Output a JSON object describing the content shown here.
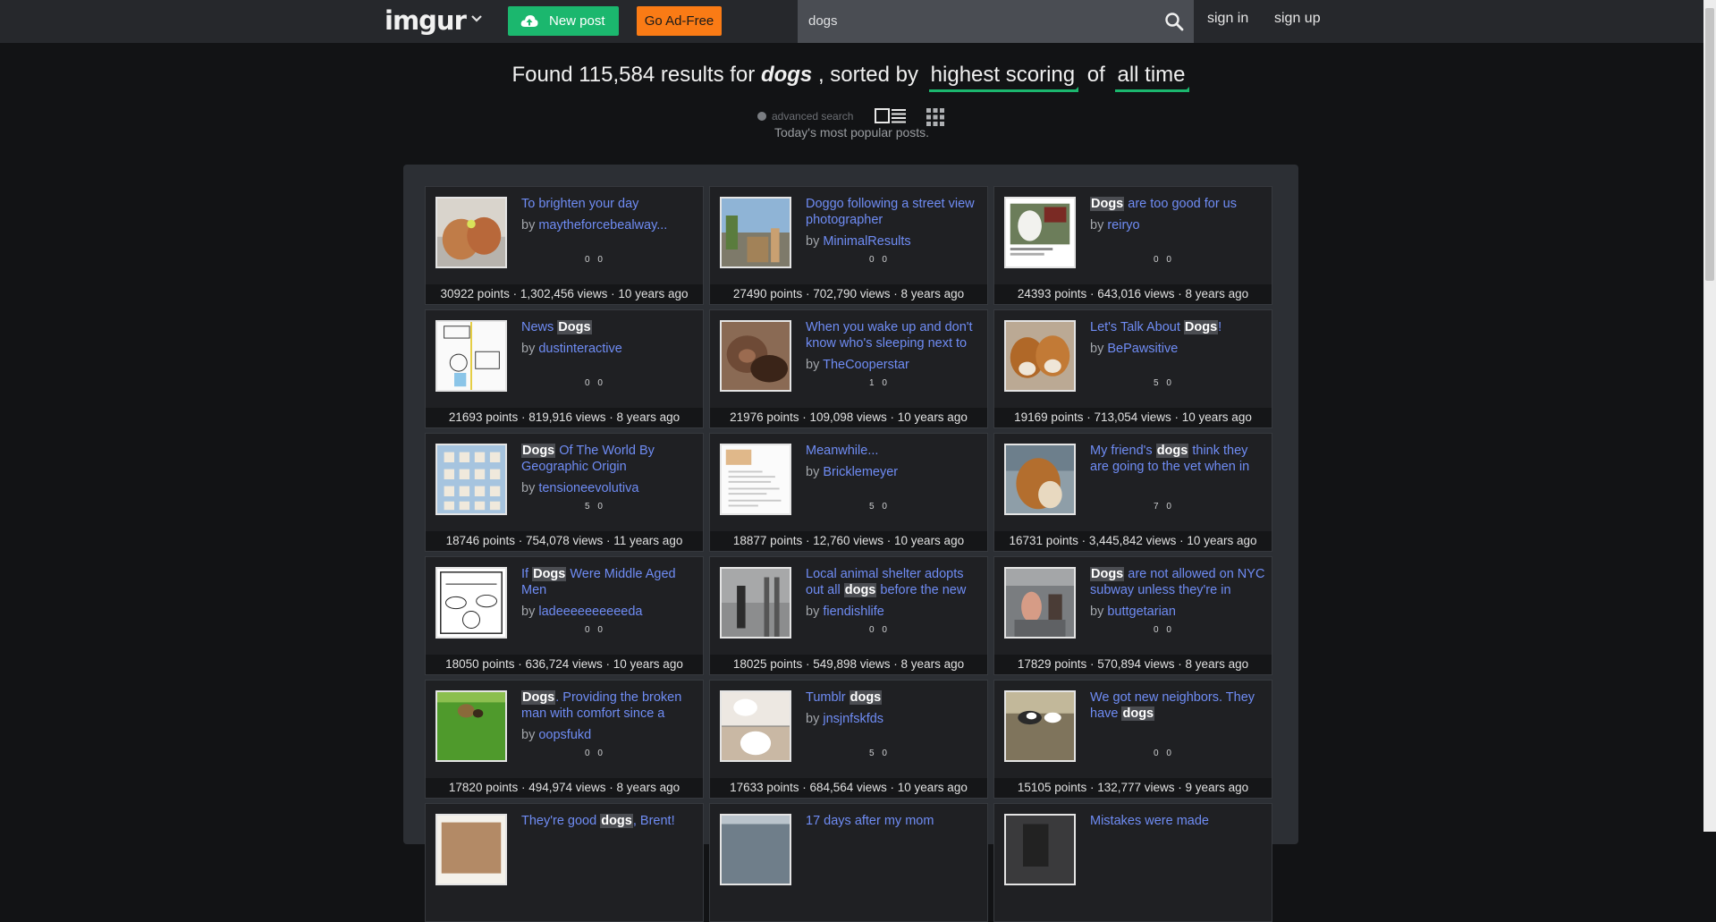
{
  "nav": {
    "logo": "imgur",
    "new_post_label": "New post",
    "ad_free_label": "Go Ad-Free",
    "search_value": "dogs",
    "signin_label": "sign in",
    "signup_label": "sign up"
  },
  "heading": {
    "found_prefix": "Found",
    "count": "115,584",
    "results_for": "results for",
    "query": "dogs",
    "sorted_by": ", sorted by",
    "sort": "highest scoring",
    "of": "of",
    "period": "all time"
  },
  "subheading": {
    "advanced_search": "advanced search",
    "popular_text": "Today's most popular posts."
  },
  "colors": {
    "accent_green": "#1bb76e",
    "accent_orange": "#fa7b15",
    "link_blue": "#6f8cf4"
  },
  "results": [
    {
      "title": [
        {
          "t": "To brighten your day"
        }
      ],
      "author": "maytheforcebealway...",
      "points": "30922 points",
      "views": "1,302,456 views",
      "age": "10 years ago",
      "dots": "0 0",
      "thumb": "puppies-tan"
    },
    {
      "title": [
        {
          "t": "Doggo following a street view photographer"
        }
      ],
      "author": "MinimalResults",
      "points": "27490 points",
      "views": "702,790 views",
      "age": "8 years ago",
      "dots": "0 0",
      "thumb": "street"
    },
    {
      "title": [
        {
          "t": "Dogs",
          "hl": true
        },
        {
          "t": " are too good for us"
        }
      ],
      "author": "reiryo",
      "points": "24393 points",
      "views": "643,016 views",
      "age": "8 years ago",
      "dots": "0 0",
      "thumb": "tweet-dog"
    },
    {
      "title": [
        {
          "t": "News "
        },
        {
          "t": "Dogs",
          "hl": true
        }
      ],
      "author": "dustinteractive",
      "points": "21693 points",
      "views": "819,916 views",
      "age": "8 years ago",
      "dots": "0 0",
      "thumb": "comic"
    },
    {
      "title": [
        {
          "t": "When you wake up and don't know who's sleeping next to"
        }
      ],
      "author": "TheCooperstar",
      "points": "21976 points",
      "views": "109,098 views",
      "age": "10 years ago",
      "dots": "1 0",
      "thumb": "sleeping"
    },
    {
      "title": [
        {
          "t": "Let's Talk About "
        },
        {
          "t": "Dogs",
          "hl": true
        },
        {
          "t": "!"
        }
      ],
      "author": "BePawsitive",
      "points": "19169 points",
      "views": "713,054 views",
      "age": "10 years ago",
      "dots": "5 0",
      "thumb": "corgis"
    },
    {
      "title": [
        {
          "t": "Dogs",
          "hl": true
        },
        {
          "t": " Of The World By Geographic Origin"
        }
      ],
      "author": "tensioneevolutiva",
      "points": "18746 points",
      "views": "754,078 views",
      "age": "11 years ago",
      "dots": "5 0",
      "thumb": "chart"
    },
    {
      "title": [
        {
          "t": "Meanwhile..."
        }
      ],
      "author": "Bricklemeyer",
      "points": "18877 points",
      "views": "12,760 views",
      "age": "10 years ago",
      "dots": "5 0",
      "thumb": "document"
    },
    {
      "title": [
        {
          "t": "My friend's "
        },
        {
          "t": "dogs",
          "hl": true
        },
        {
          "t": " think they are going to the vet when in"
        }
      ],
      "author": "",
      "points": "16731 points",
      "views": "3,445,842 views",
      "age": "10 years ago",
      "dots": "7 0",
      "thumb": "car-dogs"
    },
    {
      "title": [
        {
          "t": "If "
        },
        {
          "t": "Dogs",
          "hl": true
        },
        {
          "t": " Were Middle Aged Men"
        }
      ],
      "author": "ladeeeeeeeeeeda",
      "points": "18050 points",
      "views": "636,724 views",
      "age": "10 years ago",
      "dots": "0 0",
      "thumb": "sketch"
    },
    {
      "title": [
        {
          "t": "Local animal shelter adopts out all "
        },
        {
          "t": "dogs",
          "hl": true
        },
        {
          "t": " before the new"
        }
      ],
      "author": "fiendishlife",
      "points": "18025 points",
      "views": "549,898 views",
      "age": "8 years ago",
      "dots": "0 0",
      "thumb": "shelter"
    },
    {
      "title": [
        {
          "t": "Dogs",
          "hl": true
        },
        {
          "t": " are not allowed on NYC subway unless they're in"
        }
      ],
      "author": "buttgetarian",
      "points": "17829 points",
      "views": "570,894 views",
      "age": "8 years ago",
      "dots": "0 0",
      "thumb": "subway"
    },
    {
      "title": [
        {
          "t": "Dogs",
          "hl": true
        },
        {
          "t": ". Providing the broken man with comfort since a"
        }
      ],
      "author": "oopsfukd",
      "points": "17820 points",
      "views": "494,974 views",
      "age": "8 years ago",
      "dots": "0 0",
      "thumb": "grass"
    },
    {
      "title": [
        {
          "t": "Tumblr "
        },
        {
          "t": "dogs",
          "hl": true
        }
      ],
      "author": "jnsjnfskfds",
      "points": "17633 points",
      "views": "684,564 views",
      "age": "10 years ago",
      "dots": "5 0",
      "thumb": "white-dog"
    },
    {
      "title": [
        {
          "t": "We got new neighbors. They have "
        },
        {
          "t": "dogs",
          "hl": true
        }
      ],
      "author": "",
      "points": "15105 points",
      "views": "132,777 views",
      "age": "9 years ago",
      "dots": "0 0",
      "thumb": "yard"
    },
    {
      "title": [
        {
          "t": "They're good "
        },
        {
          "t": "dogs",
          "hl": true
        },
        {
          "t": ", Brent!"
        }
      ],
      "author": "",
      "points": "",
      "views": "",
      "age": "",
      "dots": "",
      "thumb": "meme"
    },
    {
      "title": [
        {
          "t": "17 days after my mom"
        }
      ],
      "author": "",
      "points": "",
      "views": "",
      "age": "",
      "dots": "",
      "thumb": "photo"
    },
    {
      "title": [
        {
          "t": "Mistakes were made"
        }
      ],
      "author": "",
      "points": "",
      "views": "",
      "age": "",
      "dots": "",
      "thumb": "dark"
    }
  ]
}
